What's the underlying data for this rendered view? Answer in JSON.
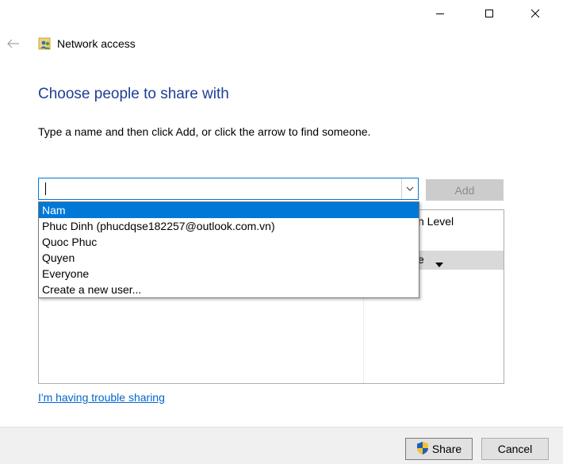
{
  "window": {
    "title": "Network access",
    "controls": {
      "minimize": "minimize",
      "maximize": "maximize",
      "close": "close"
    }
  },
  "heading": "Choose people to share with",
  "instruction": "Type a name and then click Add, or click the arrow to find someone.",
  "name_input": {
    "value": "",
    "placeholder": ""
  },
  "add_button": {
    "label": "Add",
    "enabled": false
  },
  "permission_column": {
    "header": "n Level",
    "row_value": "e"
  },
  "dropdown": {
    "items": [
      {
        "label": "Nam",
        "selected": true
      },
      {
        "label": "Phuc Dinh (phucdqse182257@outlook.com.vn)",
        "selected": false
      },
      {
        "label": "Quoc Phuc",
        "selected": false
      },
      {
        "label": "Quyen",
        "selected": false
      },
      {
        "label": "Everyone",
        "selected": false
      },
      {
        "label": "Create a new user...",
        "selected": false
      }
    ]
  },
  "trouble_link": "I'm having trouble sharing",
  "footer": {
    "share_label": "Share",
    "cancel_label": "Cancel"
  },
  "icons": {
    "back": "back-arrow-icon",
    "app": "network-users-icon",
    "combo_arrow": "chevron-down-icon",
    "perm_arrow": "triangle-down-icon",
    "shield": "uac-shield-icon"
  },
  "colors": {
    "heading": "#1c3f94",
    "selection": "#0078d7",
    "link": "#0066cc",
    "footer_bg": "#f0f0f0",
    "disabled_btn": "#cccccc"
  }
}
